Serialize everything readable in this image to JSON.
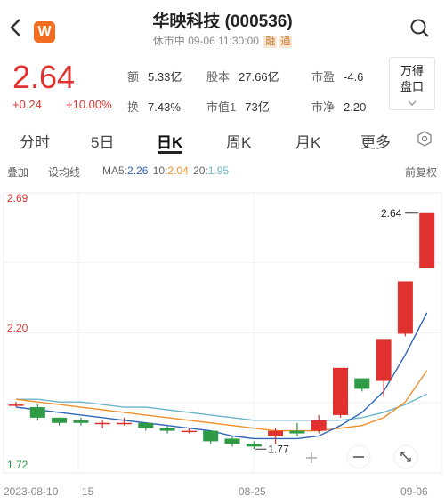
{
  "header": {
    "back_icon": "chevron-left-icon",
    "logo_text": "W",
    "title": "华映科技 (000536)",
    "status": "休市中 09-06 11:30:00",
    "tags": [
      "融",
      "通"
    ]
  },
  "quote": {
    "price": "2.64",
    "change": "+0.24",
    "change_pct": "+10.00%",
    "stats": [
      {
        "k": "额",
        "v": "5.33亿"
      },
      {
        "k": "股本",
        "v": "27.66亿"
      },
      {
        "k": "市盈",
        "v": "-4.6"
      },
      {
        "k": "换",
        "v": "7.43%"
      },
      {
        "k": "市值1",
        "v": "73亿"
      },
      {
        "k": "市净",
        "v": "2.20"
      }
    ],
    "wande_label1": "万得",
    "wande_label2": "盘口"
  },
  "tabs": [
    "分时",
    "5日",
    "日K",
    "周K",
    "月K",
    "更多"
  ],
  "selected_tab": "日K",
  "indicators": {
    "overlay": "叠加",
    "set_line": "设均线",
    "ma5_label": "MA5:",
    "ma5": "2.26",
    "ma10_label": "10:",
    "ma10": "2.04",
    "ma20_label": "20:",
    "ma20": "1.95",
    "adjust": "前复权"
  },
  "colors": {
    "up": "#e0312f",
    "down": "#2e9a45",
    "ma5": "#2f64b8",
    "ma10": "#f0902a",
    "ma20": "#6bb5c9"
  },
  "chart_data": {
    "type": "candlestick",
    "y_labels": [
      "2.69",
      "2.20",
      "1.72"
    ],
    "ylim": [
      1.72,
      2.69
    ],
    "x_labels": [
      "2023-08-10",
      "15",
      "08-25",
      "09-06"
    ],
    "max_label": "2.64",
    "min_label": "1.77",
    "candles": [
      {
        "o": 1.91,
        "h": 1.92,
        "l": 1.9,
        "c": 1.91
      },
      {
        "o": 1.9,
        "h": 1.91,
        "l": 1.85,
        "c": 1.86
      },
      {
        "o": 1.86,
        "h": 1.86,
        "l": 1.83,
        "c": 1.84
      },
      {
        "o": 1.85,
        "h": 1.86,
        "l": 1.83,
        "c": 1.84
      },
      {
        "o": 1.84,
        "h": 1.85,
        "l": 1.82,
        "c": 1.84
      },
      {
        "o": 1.84,
        "h": 1.86,
        "l": 1.83,
        "c": 1.84
      },
      {
        "o": 1.84,
        "h": 1.84,
        "l": 1.81,
        "c": 1.82
      },
      {
        "o": 1.82,
        "h": 1.83,
        "l": 1.8,
        "c": 1.81
      },
      {
        "o": 1.81,
        "h": 1.82,
        "l": 1.8,
        "c": 1.81
      },
      {
        "o": 1.81,
        "h": 1.81,
        "l": 1.76,
        "c": 1.77
      },
      {
        "o": 1.78,
        "h": 1.79,
        "l": 1.75,
        "c": 1.76
      },
      {
        "o": 1.76,
        "h": 1.77,
        "l": 1.74,
        "c": 1.75
      },
      {
        "o": 1.79,
        "h": 1.82,
        "l": 1.76,
        "c": 1.81
      },
      {
        "o": 1.81,
        "h": 1.84,
        "l": 1.79,
        "c": 1.8
      },
      {
        "o": 1.81,
        "h": 1.87,
        "l": 1.8,
        "c": 1.85
      },
      {
        "o": 1.87,
        "h": 2.05,
        "l": 1.86,
        "c": 2.05
      },
      {
        "o": 2.01,
        "h": 2.01,
        "l": 1.96,
        "c": 1.97
      },
      {
        "o": 2.0,
        "h": 2.16,
        "l": 1.94,
        "c": 2.16
      },
      {
        "o": 2.18,
        "h": 2.38,
        "l": 2.17,
        "c": 2.38
      },
      {
        "o": 2.43,
        "h": 2.64,
        "l": 2.43,
        "c": 2.64
      }
    ],
    "ma5": [
      1.9,
      1.89,
      1.88,
      1.87,
      1.86,
      1.85,
      1.84,
      1.83,
      1.82,
      1.81,
      1.79,
      1.78,
      1.78,
      1.78,
      1.79,
      1.83,
      1.88,
      1.96,
      2.1,
      2.26
    ],
    "ma10": [
      1.93,
      1.92,
      1.91,
      1.9,
      1.89,
      1.88,
      1.87,
      1.86,
      1.85,
      1.84,
      1.83,
      1.82,
      1.81,
      1.81,
      1.81,
      1.82,
      1.83,
      1.86,
      1.92,
      2.04
    ],
    "ma20": [
      1.93,
      1.93,
      1.92,
      1.92,
      1.91,
      1.9,
      1.9,
      1.89,
      1.88,
      1.87,
      1.86,
      1.85,
      1.85,
      1.85,
      1.85,
      1.85,
      1.86,
      1.88,
      1.91,
      1.95
    ]
  }
}
